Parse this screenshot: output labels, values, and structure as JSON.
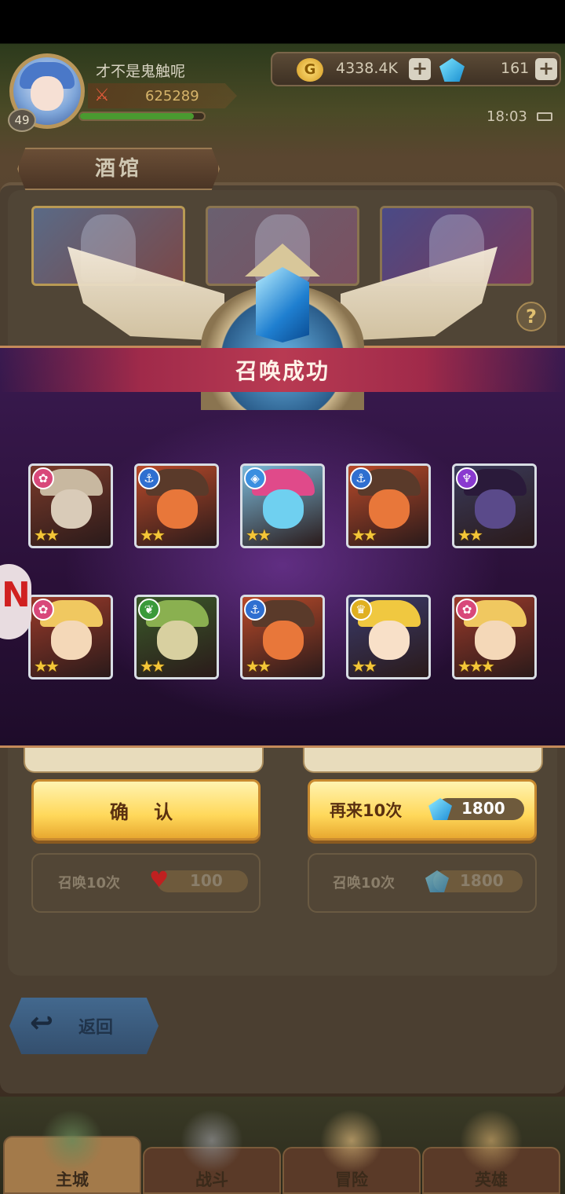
{
  "header": {
    "player_name": "才不是鬼触呢",
    "level": "49",
    "power": "625289",
    "exp_fraction": 0.92,
    "gold": "4338.4K",
    "gems": "161",
    "time": "18:03"
  },
  "tavern": {
    "title": "酒馆",
    "help": "?"
  },
  "result": {
    "title": "召唤成功",
    "heroes": [
      {
        "faction": "flower",
        "faction_color": "#d8487a",
        "stars": "★★",
        "portrait": [
          "#7a3a2a",
          "#d9cbb8",
          "#c8b8a0"
        ]
      },
      {
        "faction": "anchor",
        "faction_color": "#2f6fd0",
        "stars": "★★",
        "portrait": [
          "#b84a2a",
          "#e8773a",
          "#5a3a2a"
        ]
      },
      {
        "faction": "diamond",
        "faction_color": "#3a8fe0",
        "stars": "★★",
        "portrait": [
          "#7ab8d8",
          "#6fd0f0",
          "#e04a8a"
        ]
      },
      {
        "faction": "anchor",
        "faction_color": "#2f6fd0",
        "stars": "★★",
        "portrait": [
          "#b84a2a",
          "#e8773a",
          "#5a3a2a"
        ]
      },
      {
        "faction": "horns",
        "faction_color": "#8a3ad0",
        "stars": "★★",
        "portrait": [
          "#3a3a5a",
          "#5a4a8a",
          "#2a1a3a"
        ]
      },
      {
        "faction": "flower",
        "faction_color": "#d8487a",
        "stars": "★★",
        "portrait": [
          "#9a3a2a",
          "#f4d8b8",
          "#f0c860"
        ]
      },
      {
        "faction": "leaf",
        "faction_color": "#3a9a3a",
        "stars": "★★",
        "portrait": [
          "#3a5a2a",
          "#d8d0a0",
          "#8ab050"
        ]
      },
      {
        "faction": "anchor",
        "faction_color": "#2f6fd0",
        "stars": "★★",
        "portrait": [
          "#b84a2a",
          "#e8773a",
          "#5a3a2a"
        ]
      },
      {
        "faction": "crown",
        "faction_color": "#e0b020",
        "stars": "★★",
        "portrait": [
          "#3a3a6a",
          "#f8e0c8",
          "#f0c840"
        ]
      },
      {
        "faction": "flower",
        "faction_color": "#d8487a",
        "stars": "★★★",
        "portrait": [
          "#9a3a2a",
          "#f4d8b8",
          "#f0c860"
        ]
      }
    ]
  },
  "actions": {
    "confirm": "确 认",
    "again": "再来10次",
    "again_cost": "1800",
    "summon_heart_label": "召唤10次",
    "summon_heart_cost": "100",
    "summon_gem_label": "召唤10次",
    "summon_gem_cost": "1800",
    "back": "返回"
  },
  "nav": [
    {
      "label": "主城",
      "active": true
    },
    {
      "label": "战斗",
      "active": false
    },
    {
      "label": "冒险",
      "active": false
    },
    {
      "label": "英雄",
      "active": false
    }
  ],
  "colors": {
    "accent_gold": "#ffd85a",
    "ribbon_red": "#b83a52",
    "overlay_purple": "#3a1a50"
  },
  "icons": {
    "gold": "gold-coin-icon",
    "gem": "blue-gem-icon",
    "heart": "heart-icon",
    "back": "back-arrow-icon",
    "help": "question-icon"
  }
}
